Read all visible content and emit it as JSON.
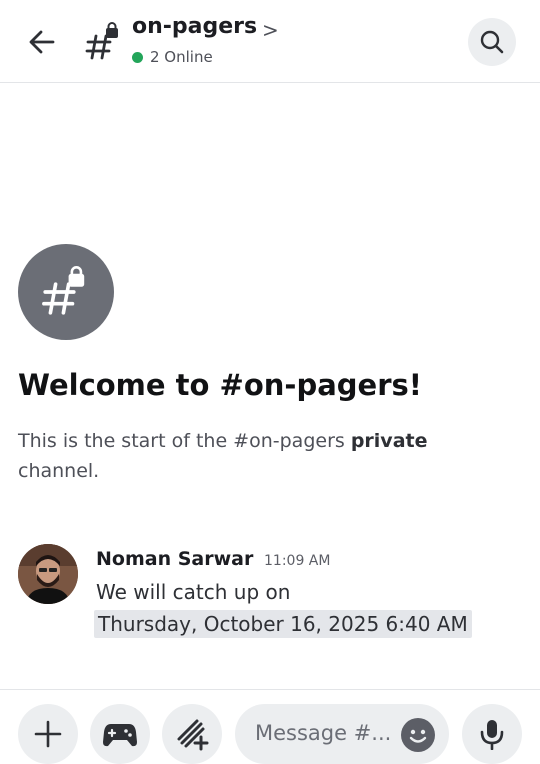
{
  "header": {
    "channel_name": "on-pagers",
    "chevron": ">",
    "online_text": "2 Online"
  },
  "welcome": {
    "title": "Welcome to #on-pagers!",
    "desc_prefix": "This is the start of the #on-pagers ",
    "desc_bold": "private",
    "desc_suffix": " channel."
  },
  "message": {
    "author": "Noman Sarwar",
    "time": "11:09 AM",
    "line1": "We will catch up on",
    "line2": "Thursday, October 16, 2025 6:40 AM"
  },
  "composer": {
    "placeholder": "Message #..."
  },
  "icons": {
    "back": "arrow-left-icon",
    "channel": "private-channel-icon",
    "search": "search-icon",
    "add": "plus-icon",
    "games": "gamepad-icon",
    "apps": "apps-icon",
    "emoji": "emoji-icon",
    "mic": "microphone-icon"
  },
  "colors": {
    "online": "#23a55a",
    "avatar_bg": "#6b6e76",
    "button_bg": "#eceef0"
  }
}
